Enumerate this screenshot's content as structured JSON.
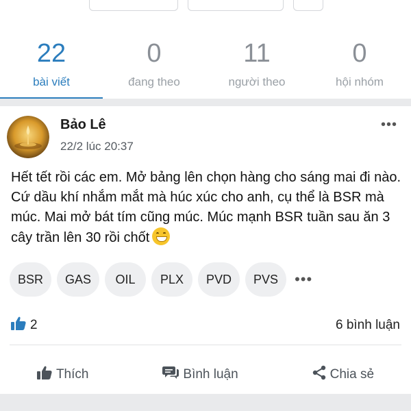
{
  "stats": [
    {
      "value": "22",
      "label": "bài viết",
      "active": true
    },
    {
      "value": "0",
      "label": "đang theo",
      "active": false
    },
    {
      "value": "11",
      "label": "người theo",
      "active": false
    },
    {
      "value": "0",
      "label": "hội nhóm",
      "active": false
    }
  ],
  "post": {
    "author": "Bảo Lê",
    "time": "22/2 lúc 20:37",
    "text": "Hết tết rồi các em. Mở bảng lên chọn hàng cho sáng mai đi nào. Cứ dầu khí nhắm mắt mà húc xúc cho anh, cụ thể là BSR mà múc. Mai mở bát tím cũng múc. Múc mạnh BSR tuần sau ăn 3 cây trần lên 30 rồi chốt",
    "emoji": "grinning-face",
    "tags": [
      "BSR",
      "GAS",
      "OIL",
      "PLX",
      "PVD",
      "PVS"
    ],
    "tags_more": "•••",
    "more_menu": "•••",
    "likes_count": "2",
    "comments_count": "6 bình luận",
    "actions": {
      "like": "Thích",
      "comment": "Bình luận",
      "share": "Chia sẻ"
    }
  },
  "colors": {
    "accent": "#2b7dbd",
    "muted": "#9aa0a6",
    "background": "#e9eaec"
  }
}
